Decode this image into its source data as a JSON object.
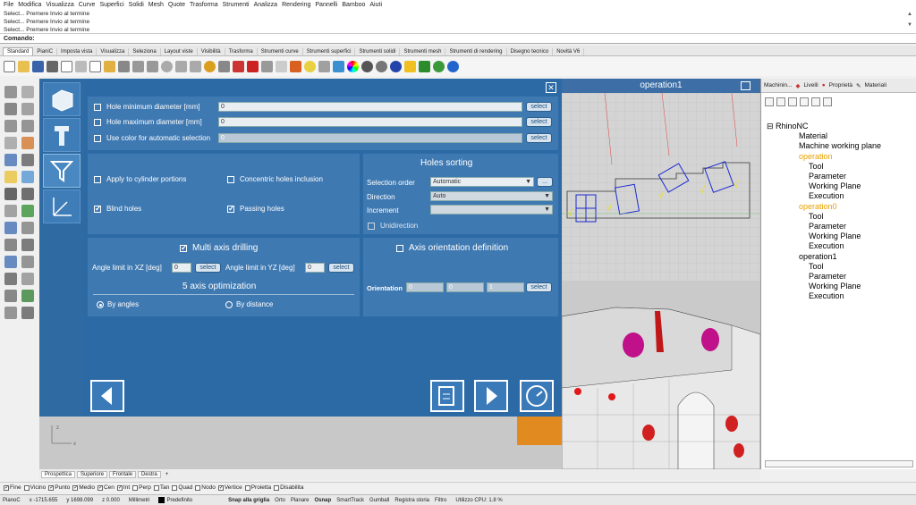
{
  "menu": [
    "File",
    "Modifica",
    "Visualizza",
    "Curve",
    "Superfici",
    "Solidi",
    "Mesh",
    "Quote",
    "Trasforma",
    "Strumenti",
    "Analizza",
    "Rendering",
    "Pannelli",
    "Bamboo",
    "Aiuti"
  ],
  "command_history": [
    "Select... Premere Invio al termine",
    "Select... Premere Invio al termine",
    "Select... Premere Invio al termine"
  ],
  "command_prompt": "Comando:",
  "toolbar_tabs": [
    "Standard",
    "PianiC",
    "Imposta vista",
    "Visualizza",
    "Seleziona",
    "Layout viste",
    "Visibilità",
    "Trasforma",
    "Strumenti curve",
    "Strumenti superfici",
    "Strumenti solidi",
    "Strumenti mesh",
    "Strumenti di rendering",
    "Disegno tecnico",
    "Novità V6"
  ],
  "dialog": {
    "close_icon": "close-icon",
    "hole_min_label": "Hole minimum diameter [mm]",
    "hole_min_value": "0",
    "hole_max_label": "Hole maximum diameter [mm]",
    "hole_max_value": "0",
    "use_color_label": "Use color for automatic selection",
    "use_color_value": "0",
    "select_label": "select",
    "apply_cyl_label": "Apply to cylinder portions",
    "concentric_label": "Concentric holes inclusion",
    "blind_label": "Blind holes",
    "passing_label": "Passing holes",
    "sorting_title": "Holes sorting",
    "sel_order_label": "Selection order",
    "sel_order_value": "Automatic",
    "more_label": "...",
    "direction_label": "Direction",
    "direction_value": "Auto",
    "increment_label": "Increment",
    "increment_value": "",
    "unidirection_label": "Unidirection",
    "multi_axis_label": "Multi axis drilling",
    "angle_xz_label": "Angle limit in XZ [deg]",
    "angle_xz_value": "0",
    "angle_yz_label": "Angle limit in YZ [deg]",
    "angle_yz_value": "0",
    "five_axis_title": "5 axis optimization",
    "by_angles_label": "By angles",
    "by_distance_label": "By distance",
    "axis_orient_label": "Axis orientation definition",
    "orientation_label": "Orientation",
    "orient_x": "0",
    "orient_y": "0",
    "orient_z": "1"
  },
  "viewport": {
    "title": "operation1",
    "tabs": [
      "Prospettica",
      "Superiore",
      "Frontale",
      "Destra"
    ],
    "add_tab": "+"
  },
  "right_panel": {
    "tabs": [
      "Machinin...",
      "Livelli",
      "Proprietà",
      "Materiali"
    ],
    "tree": {
      "root": "RhinoNC",
      "material": "Material",
      "mwp": "Machine working plane",
      "ops": [
        {
          "name": "operation",
          "children": [
            "Tool",
            "Parameter",
            "Working Plane",
            "Execution"
          ]
        },
        {
          "name": "operation0",
          "children": [
            "Tool",
            "Parameter",
            "Working Plane",
            "Execution"
          ]
        },
        {
          "name": "operation1",
          "children": [
            "Tool",
            "Parameter",
            "Working Plane",
            "Execution"
          ]
        }
      ]
    }
  },
  "osnap": [
    "Fine",
    "Vicino",
    "Punto",
    "Medio",
    "Cen",
    "Int",
    "Perp",
    "Tan",
    "Quad",
    "Nodo",
    "Vertice",
    "Proietta",
    "Disabilita"
  ],
  "osnap_checked": [
    true,
    false,
    true,
    true,
    true,
    true,
    false,
    false,
    false,
    false,
    true,
    false,
    false
  ],
  "status": {
    "cplane": "PianoC",
    "x": "x -1715.655",
    "y": "y 1698.099",
    "z": "z 0.000",
    "units": "Millimetri",
    "layer": "Predefinito",
    "items": [
      "Snap alla griglia",
      "Orto",
      "Planare",
      "Osnap",
      "SmartTrack",
      "Gumball",
      "Registra storia",
      "Filtro"
    ],
    "cpu": "Utilizzo CPU: 1.8 %"
  }
}
